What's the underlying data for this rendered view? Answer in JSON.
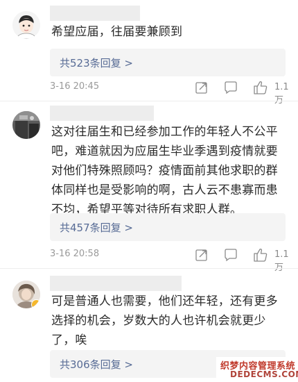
{
  "comments": [
    {
      "text_lines": [
        "希望应届，往届要兼顾到"
      ],
      "reply_label": "共523条回复 >",
      "timestamp": "3-16 20:45",
      "likes": "1.1万"
    },
    {
      "text_lines": [
        "这对往届生和已经参加工作的年轻人不公平",
        "吧，难道就因为应届生毕业季遇到疫情就要",
        "对他们特殊照顾吗？疫情面前其他求职的群",
        "体同样也是受影响的啊，古人云不患寡而患",
        "不均，希望平等对待所有求职人群。"
      ],
      "reply_label": "共457条回复 >",
      "timestamp": "3-16 20:58",
      "likes": "1.1万"
    },
    {
      "text_lines": [
        "可是普通人也需要，他们还年轻，还有更多",
        "选择的机会，岁数大的人也许机会就更少",
        "了，唉"
      ],
      "reply_label": "共306条回复 >"
    }
  ],
  "icons": {
    "share": "share-icon",
    "comment": "comment-icon",
    "like": "thumbs-up-icon"
  },
  "watermark": {
    "line1": "织梦内容管理系统",
    "line2": "DEDECMS.COM"
  },
  "colors": {
    "link": "#576b95",
    "meta_gray": "#9a9a9a",
    "reply_bg": "#f4f4f4",
    "watermark_red": "#c0392b"
  }
}
